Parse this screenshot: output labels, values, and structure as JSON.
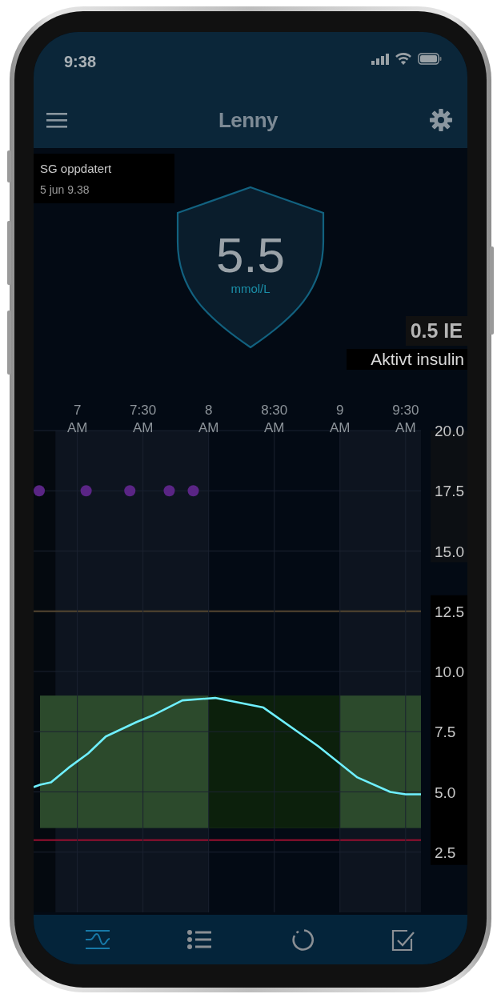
{
  "status_bar": {
    "time": "9:38"
  },
  "header": {
    "title": "Lenny"
  },
  "sensor_update": {
    "label": "SG oppdatert",
    "time": "5 jun 9.38"
  },
  "glucose": {
    "value": "5.5",
    "unit": "mmol/L"
  },
  "active_insulin": {
    "amount": "0.5 IE",
    "label": "Aktivt insulin"
  },
  "chart": {
    "chart_data": {
      "type": "line",
      "xlim": [
        6.667,
        9.617
      ],
      "ylim": [
        0,
        20
      ],
      "xticks": [
        {
          "value": 7,
          "label": "7 AM"
        },
        {
          "value": 7.5,
          "label": "7:30 AM"
        },
        {
          "value": 8,
          "label": "8 AM"
        },
        {
          "value": 8.5,
          "label": "8:30 AM"
        },
        {
          "value": 9,
          "label": "9 AM"
        },
        {
          "value": 9.5,
          "label": "9:30 AM"
        }
      ],
      "yticks": [
        {
          "value": 20,
          "label": "20.0"
        },
        {
          "value": 17.5,
          "label": "17.5"
        },
        {
          "value": 15,
          "label": "15.0"
        },
        {
          "value": 12.5,
          "label": "12.5"
        },
        {
          "value": 10,
          "label": "10.0"
        },
        {
          "value": 7.5,
          "label": "7.5"
        },
        {
          "value": 5,
          "label": "5.0"
        },
        {
          "value": 2.5,
          "label": "2.5"
        }
      ],
      "series": [
        {
          "color": "#6ff0ff",
          "x": [
            6.667,
            6.717,
            6.8,
            6.933,
            7.083,
            7.217,
            7.45,
            7.583,
            7.8,
            8.05,
            8.417,
            8.833,
            9.133,
            9.383,
            9.5,
            9.617
          ],
          "values": [
            5.2,
            5.3,
            5.4,
            6.0,
            6.6,
            7.3,
            7.9,
            8.2,
            8.8,
            8.9,
            8.5,
            6.9,
            5.6,
            5.0,
            4.9,
            4.9
          ]
        },
        {
          "type": "scatter",
          "color": "#5a2585",
          "x": [
            6.7,
            7.067,
            7.4,
            7.7,
            7.883
          ],
          "values": [
            17.5,
            17.5,
            17.5,
            17.5,
            17.5
          ]
        }
      ],
      "grid": true
    }
  },
  "tabs": [
    {
      "kind": "graph",
      "selected": true
    },
    {
      "kind": "list",
      "selected": false
    },
    {
      "kind": "ring",
      "selected": false
    },
    {
      "kind": "check",
      "selected": false
    }
  ]
}
